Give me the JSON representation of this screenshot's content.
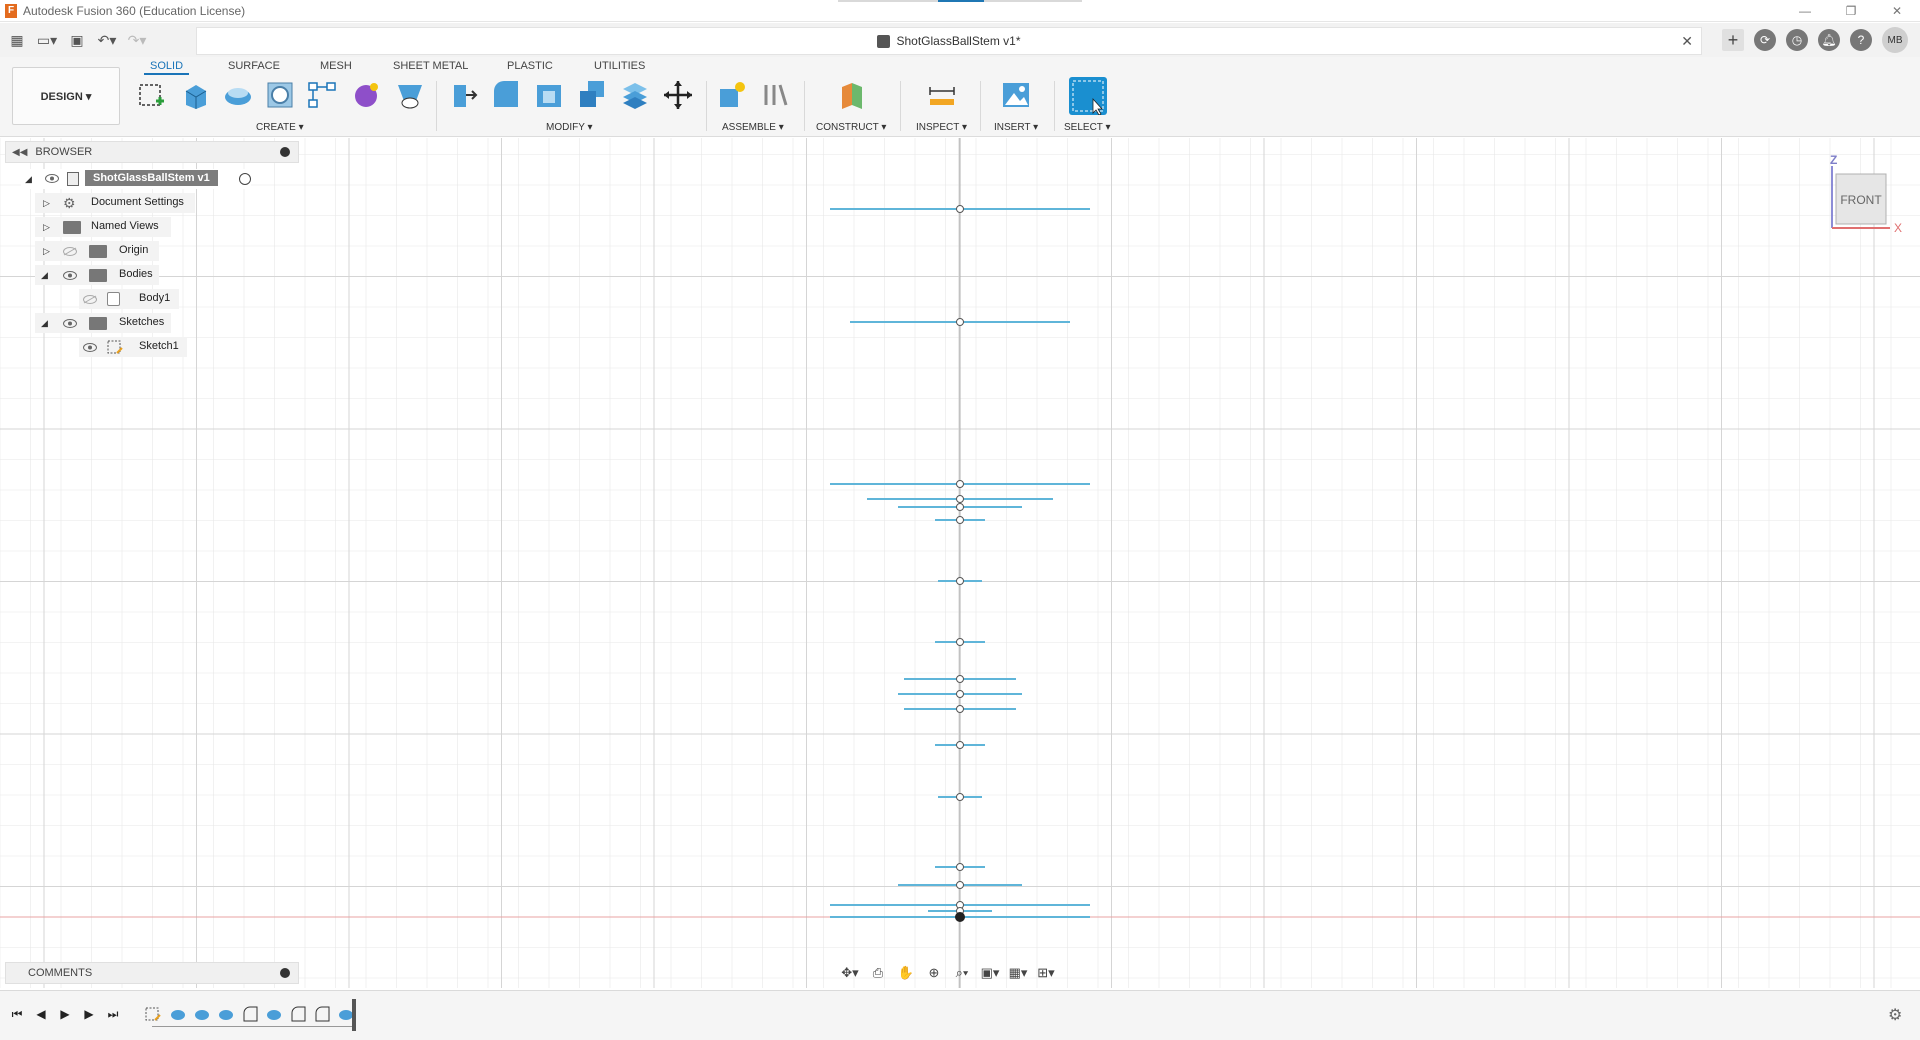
{
  "window": {
    "title": "Autodesk Fusion 360 (Education License)",
    "controls": [
      "—",
      "❐",
      "✕"
    ]
  },
  "document": {
    "tab_title": "ShotGlassBallStem v1*",
    "user_initials": "MB"
  },
  "workspace": {
    "button_label": "DESIGN ▾",
    "tabs": [
      "SOLID",
      "SURFACE",
      "MESH",
      "SHEET METAL",
      "PLASTIC",
      "UTILITIES"
    ],
    "active_tab": "SOLID"
  },
  "toolbar_groups": {
    "create": "CREATE ▾",
    "modify": "MODIFY ▾",
    "assemble": "ASSEMBLE ▾",
    "construct": "CONSTRUCT ▾",
    "inspect": "INSPECT ▾",
    "insert": "INSERT ▾",
    "select": "SELECT ▾"
  },
  "browser": {
    "title": "BROWSER",
    "root": "ShotGlassBallStem v1",
    "items": [
      {
        "label": "Document Settings",
        "icon": "gear-icon"
      },
      {
        "label": "Named Views",
        "icon": "folder-icon"
      },
      {
        "label": "Origin",
        "icon": "folder-icon"
      },
      {
        "label": "Bodies",
        "icon": "folder-icon"
      },
      {
        "label": "Body1",
        "icon": "body-icon"
      },
      {
        "label": "Sketches",
        "icon": "folder-icon"
      },
      {
        "label": "Sketch1",
        "icon": "sketch-icon"
      }
    ]
  },
  "comments": {
    "title": "COMMENTS"
  },
  "viewcube": {
    "face": "FRONT",
    "axis_z": "Z",
    "axis_x": "X"
  },
  "colors": {
    "accent": "#1a74b8",
    "sketch_line": "#5fb5d9",
    "origin_red": "#e8a3a3",
    "grid": "#e8e8e8",
    "grid_major": "#d5d5d5"
  }
}
